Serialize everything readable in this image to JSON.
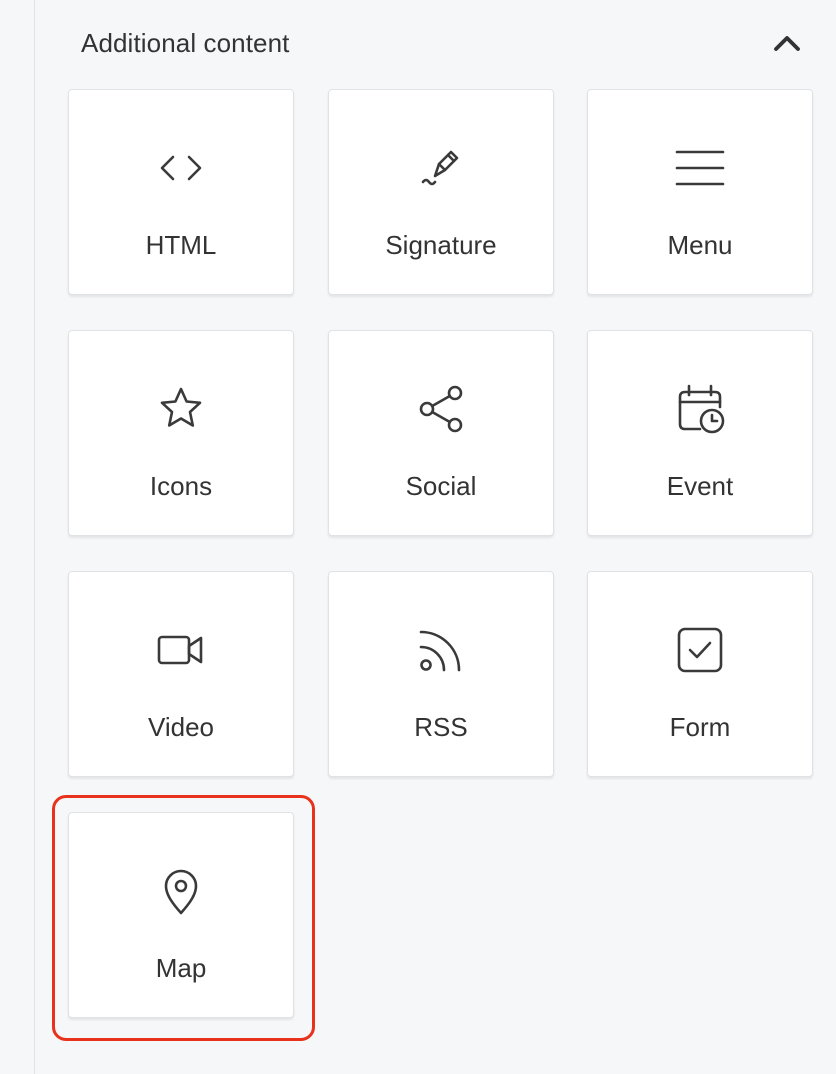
{
  "section": {
    "title": "Additional content",
    "toggle_icon": "chevron-up-icon"
  },
  "tiles": [
    {
      "label": "HTML",
      "icon": "code-icon"
    },
    {
      "label": "Signature",
      "icon": "pen-signature-icon"
    },
    {
      "label": "Menu",
      "icon": "menu-lines-icon"
    },
    {
      "label": "Icons",
      "icon": "star-icon"
    },
    {
      "label": "Social",
      "icon": "share-icon"
    },
    {
      "label": "Event",
      "icon": "calendar-clock-icon"
    },
    {
      "label": "Video",
      "icon": "video-camera-icon"
    },
    {
      "label": "RSS",
      "icon": "rss-icon"
    },
    {
      "label": "Form",
      "icon": "checkbox-icon"
    },
    {
      "label": "Map",
      "icon": "map-pin-icon"
    }
  ],
  "colors": {
    "highlight": "#e8321c",
    "background": "#f6f7f9",
    "tile": "#ffffff",
    "text": "#333333"
  }
}
